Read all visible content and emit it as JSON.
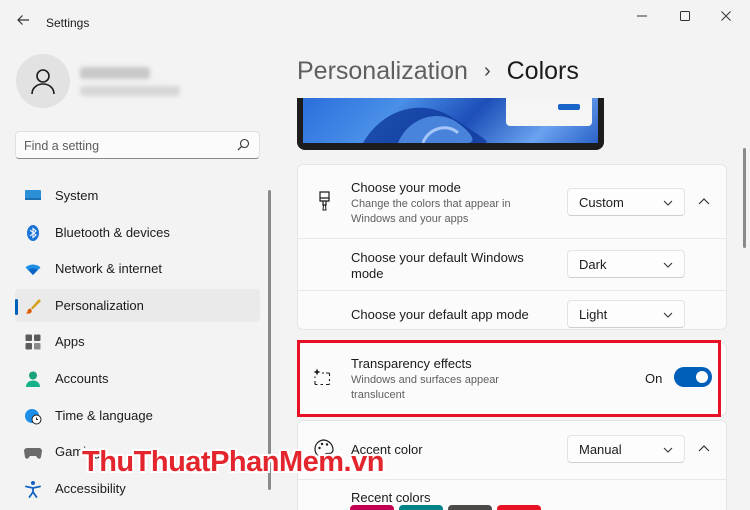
{
  "window": {
    "title": "Settings",
    "back_icon": "back-arrow-icon",
    "controls": {
      "minimize": "minimize-icon",
      "maximize": "maximize-icon",
      "close": "close-icon"
    }
  },
  "profile": {
    "avatar_icon": "person-icon"
  },
  "search": {
    "placeholder": "Find a setting",
    "icon": "search-icon"
  },
  "sidebar": {
    "items": [
      {
        "label": "System",
        "icon": "monitor-icon"
      },
      {
        "label": "Bluetooth & devices",
        "icon": "bluetooth-icon"
      },
      {
        "label": "Network & internet",
        "icon": "wifi-icon"
      },
      {
        "label": "Personalization",
        "icon": "brush-icon",
        "selected": true
      },
      {
        "label": "Apps",
        "icon": "apps-icon"
      },
      {
        "label": "Accounts",
        "icon": "account-icon"
      },
      {
        "label": "Time & language",
        "icon": "globe-clock-icon"
      },
      {
        "label": "Gaming",
        "icon": "gamepad-icon"
      },
      {
        "label": "Accessibility",
        "icon": "accessibility-icon"
      }
    ]
  },
  "breadcrumb": {
    "parent": "Personalization",
    "separator": "›",
    "current": "Colors"
  },
  "settings": {
    "mode": {
      "title": "Choose your mode",
      "description": "Change the colors that appear in Windows and your apps",
      "value": "Custom",
      "icon": "paintbrush-icon"
    },
    "windows_mode": {
      "title": "Choose your default Windows mode",
      "value": "Dark"
    },
    "app_mode": {
      "title": "Choose your default app mode",
      "value": "Light"
    },
    "transparency": {
      "title": "Transparency effects",
      "description": "Windows and surfaces appear translucent",
      "state_label": "On",
      "enabled": true,
      "icon": "transparency-icon"
    },
    "accent": {
      "title": "Accent color",
      "value": "Manual",
      "icon": "palette-icon"
    },
    "recent_colors": {
      "title": "Recent colors",
      "colors": [
        "#c30052",
        "#038387",
        "#4c4a48",
        "#e81123"
      ]
    }
  },
  "colors": {
    "accent": "#005fb8",
    "highlight": "#e81123"
  },
  "watermark": "ThuThuatPhanMem.vn"
}
